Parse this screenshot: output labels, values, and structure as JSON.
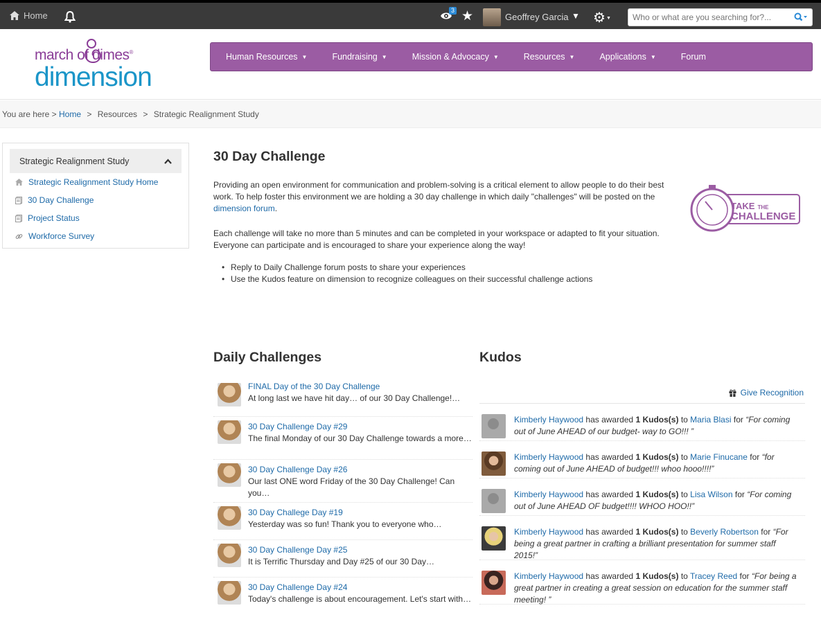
{
  "topbar": {
    "home_label": "Home",
    "eye_badge": "3",
    "user_name": "Geoffrey Garcia",
    "search_placeholder": "Who or what are you searching for?..."
  },
  "logo": {
    "line1": "march of dimes",
    "registered": "®",
    "line2": "dimension"
  },
  "nav": {
    "items": [
      {
        "label": "Human Resources",
        "dropdown": true
      },
      {
        "label": "Fundraising",
        "dropdown": true
      },
      {
        "label": "Mission & Advocacy",
        "dropdown": true
      },
      {
        "label": "Resources",
        "dropdown": true
      },
      {
        "label": "Applications",
        "dropdown": true
      },
      {
        "label": "Forum",
        "dropdown": false
      }
    ]
  },
  "breadcrumb": {
    "prefix": "You are here",
    "sep": ">",
    "home": "Home",
    "resources": "Resources",
    "current": "Strategic Realignment Study"
  },
  "sidebar": {
    "heading": "Strategic Realignment Study",
    "items": [
      {
        "label": "Strategic Realignment Study Home",
        "icon": "home-icon"
      },
      {
        "label": "30 Day Challenge",
        "icon": "page-icon"
      },
      {
        "label": "Project Status",
        "icon": "page-icon"
      },
      {
        "label": "Workforce Survey",
        "icon": "link-icon"
      }
    ]
  },
  "main": {
    "title": "30 Day Challenge",
    "para1": "Providing an open environment for communication and problem-solving is a critical element to allow people to do their best work.  To help foster this environment we are holding a 30 day challenge in which daily \"challenges\" will be posted on the",
    "para1_link": "dimension forum",
    "para1_end": ".",
    "para2": "Each challenge will take no more than 5 minutes and can be completed in your workspace or adapted to fit your situation. Everyone can participate and is encouraged to share your experience along the way!",
    "bullets": [
      "Reply to Daily Challenge forum posts to share your experiences",
      "Use the Kudos feature on dimension to recognize colleagues on their successful challenge actions"
    ],
    "badge": {
      "line1": "TAKE",
      "the": "THE",
      "line2": "CHALLENGE"
    }
  },
  "daily": {
    "heading": "Daily Challenges",
    "items": [
      {
        "title": "FINAL Day of the 30 Day Challenge",
        "text": "At long last we have hit day… of our 30 Day Challenge!…"
      },
      {
        "title": "30 Day Challenge Day #29",
        "text": "The final Monday of our 30 Day Challenge towards a more…"
      },
      {
        "title": "30 Day Challenge Day #26",
        "text": "Our last ONE word Friday of the 30 Day Challenge! Can you…"
      },
      {
        "title": "30 Day Challege Day #19",
        "text": "Yesterday was so fun! Thank you to everyone who…"
      },
      {
        "title": "30 Day Challenge Day #25",
        "text": "It is Terrific Thursday and Day #25 of our 30 Day…"
      },
      {
        "title": "30 Day Challenge Day #24",
        "text": "Today's challenge is about encouragement. Let's start with…"
      }
    ]
  },
  "kudos": {
    "heading": "Kudos",
    "give_label": "Give Recognition",
    "items": [
      {
        "from": "Kimberly Haywood",
        "verb": "has awarded",
        "amount": "1 Kudos(s)",
        "to_word": "to",
        "to": "Maria Blasi",
        "for_word": "for",
        "reason": "“For coming out of June AHEAD of our budget- way to GO!!! ”",
        "avatar": "blank"
      },
      {
        "from": "Kimberly Haywood",
        "verb": "has awarded",
        "amount": "1 Kudos(s)",
        "to_word": "to",
        "to": "Marie Finucane",
        "for_word": "for",
        "reason": "“for coming out of June AHEAD of budget!!! whoo hooo!!!!”",
        "avatar": "p1"
      },
      {
        "from": "Kimberly Haywood",
        "verb": "has awarded",
        "amount": "1 Kudos(s)",
        "to_word": "to",
        "to": "Lisa Wilson",
        "for_word": "for",
        "reason": "“For coming out of June AHEAD OF budget!!!! WHOO HOO!!”",
        "avatar": "blank"
      },
      {
        "from": "Kimberly Haywood",
        "verb": "has awarded",
        "amount": "1 Kudos(s)",
        "to_word": "to",
        "to": "Beverly Robertson",
        "for_word": "for",
        "reason": "“For being a great partner in crafting a brilliant presentation for summer staff 2015!”",
        "avatar": "p2"
      },
      {
        "from": "Kimberly Haywood",
        "verb": "has awarded",
        "amount": "1 Kudos(s)",
        "to_word": "to",
        "to": "Tracey Reed",
        "for_word": "for",
        "reason": "“For being a great partner in creating a great session on education for the summer staff meeting! ”",
        "avatar": "p3"
      }
    ]
  },
  "colors": {
    "nav_purple": "#9b5ca3",
    "link_blue": "#1e6aa8",
    "logo_purple": "#8a3d97",
    "logo_blue": "#1b95c8"
  }
}
